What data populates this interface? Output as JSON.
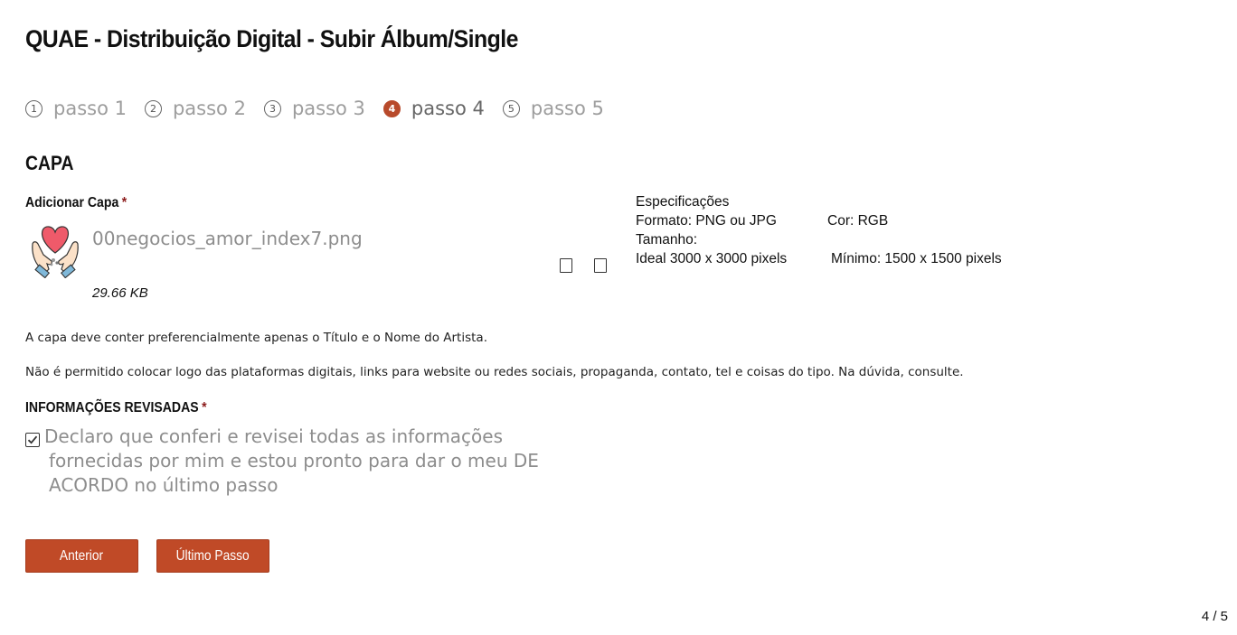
{
  "page": {
    "title": "QUAE - Distribuição Digital - Subir Álbum/Single"
  },
  "steps": [
    {
      "number": "1",
      "label": "passo 1",
      "active": false
    },
    {
      "number": "2",
      "label": "passo 2",
      "active": false
    },
    {
      "number": "3",
      "label": "passo 3",
      "active": false
    },
    {
      "number": "4",
      "label": "passo 4",
      "active": true
    },
    {
      "number": "5",
      "label": "passo 5",
      "active": false
    }
  ],
  "cover": {
    "section_title": "CAPA",
    "field_label": "Adicionar Capa",
    "required_mark": "*",
    "file_name": "00negocios_amor_index7.png",
    "file_size": "29.66 KB",
    "thumbnail_icon": "heart-hands-icon",
    "actions": [
      {
        "icon": "edit-icon"
      },
      {
        "icon": "delete-icon"
      }
    ]
  },
  "specs": {
    "title": "Especificações",
    "format": "Formato: PNG ou JPG",
    "color": "Cor: RGB",
    "size_label": "Tamanho:",
    "ideal": "Ideal 3000 x 3000 pixels",
    "minimum": "Mínimo: 1500 x 1500 pixels"
  },
  "notes": [
    "A capa deve conter preferencialmente apenas o Título e o Nome do Artista.",
    "Não é permitido colocar logo das plataformas digitais, links para website ou redes sociais, propaganda, contato, tel e coisas do tipo. Na dúvida, consulte."
  ],
  "review": {
    "label": "INFORMAÇÕES REVISADAS",
    "required_mark": "*",
    "checkbox_checked": true,
    "checkbox_text": "Declaro que conferi e revisei todas as informações fornecidas por mim e estou pronto para dar o meu DE ACORDO no último passo"
  },
  "buttons": {
    "previous": "Anterior",
    "next": "Último Passo"
  },
  "pager": "4 / 5",
  "colors": {
    "accent": "#c04a27",
    "required": "#8b1a1a",
    "muted_text": "#8d8d8d"
  }
}
